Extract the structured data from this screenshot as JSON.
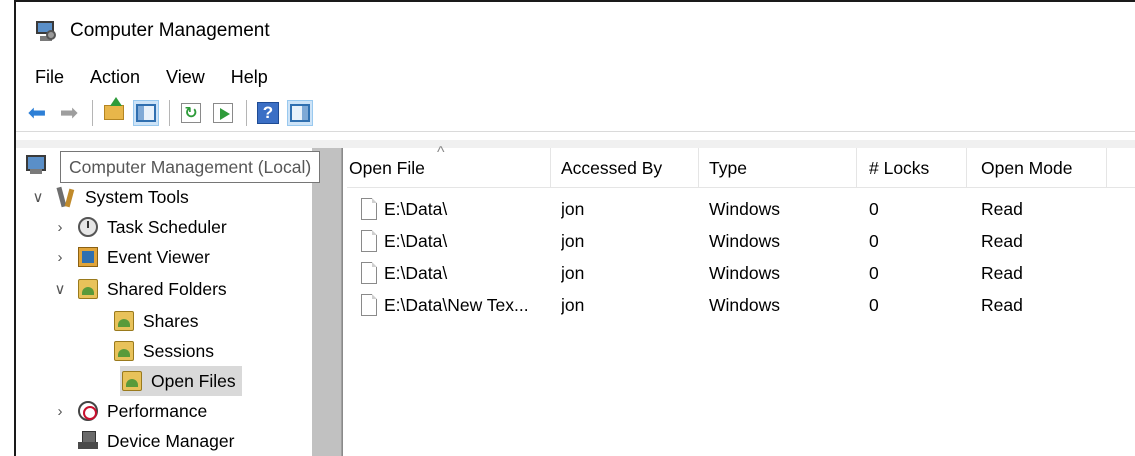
{
  "window": {
    "title": "Computer Management",
    "menu": [
      "File",
      "Action",
      "View",
      "Help"
    ],
    "toolbar_icons": [
      "back-arrow-icon",
      "forward-arrow-icon",
      "up-folder-icon",
      "show-hide-console-tree-icon",
      "refresh-icon",
      "export-list-icon",
      "help-icon",
      "show-hide-action-pane-icon"
    ]
  },
  "tree": {
    "tooltip": "Computer Management (Local)",
    "items": [
      {
        "label": "System Tools",
        "chevron": "∨"
      },
      {
        "label": "Task Scheduler",
        "chevron": "›"
      },
      {
        "label": "Event Viewer",
        "chevron": "›"
      },
      {
        "label": "Shared Folders",
        "chevron": "∨"
      },
      {
        "label": "Shares"
      },
      {
        "label": "Sessions"
      },
      {
        "label": "Open Files",
        "selected": true
      },
      {
        "label": "Performance",
        "chevron": "›"
      },
      {
        "label": "Device Manager"
      }
    ]
  },
  "list": {
    "columns": [
      "Open File",
      "Accessed By",
      "Type",
      "# Locks",
      "Open Mode"
    ],
    "rows": [
      [
        "E:\\Data\\",
        "jon",
        "Windows",
        "0",
        "Read"
      ],
      [
        "E:\\Data\\",
        "jon",
        "Windows",
        "0",
        "Read"
      ],
      [
        "E:\\Data\\",
        "jon",
        "Windows",
        "0",
        "Read"
      ],
      [
        "E:\\Data\\New Tex...",
        "jon",
        "Windows",
        "0",
        "Read"
      ]
    ]
  }
}
